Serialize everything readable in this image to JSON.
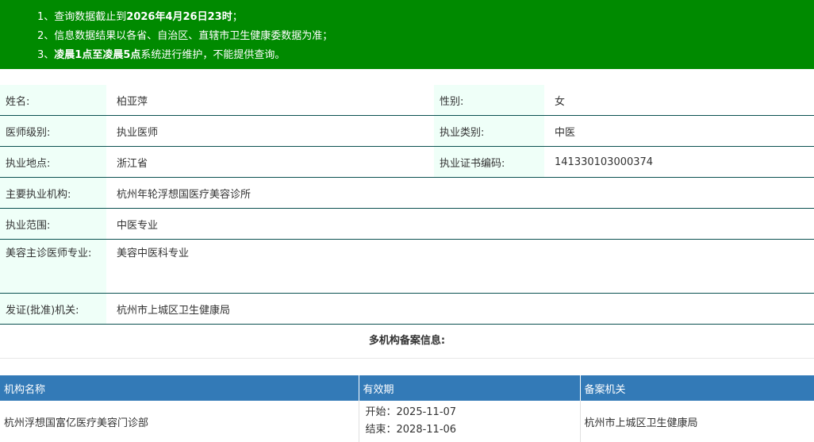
{
  "notice": {
    "line1_prefix": "1、查询数据截止到",
    "line1_bold": "2026年4月26日23时",
    "line1_suffix": "；",
    "line2": "2、信息数据结果以各省、自治区、直辖市卫生健康委数据为准；",
    "line3_prefix": "3、",
    "line3_bold": "凌晨1点至凌晨5点",
    "line3_suffix": "系统进行维护，不能提供查询。"
  },
  "info": {
    "name_label": "姓名:",
    "name_value": "柏亚萍",
    "gender_label": "性别:",
    "gender_value": "女",
    "level_label": "医师级别:",
    "level_value": "执业医师",
    "category_label": "执业类别:",
    "category_value": "中医",
    "location_label": "执业地点:",
    "location_value": "浙江省",
    "cert_label": "执业证书编码:",
    "cert_value": "141330103000374",
    "org_label": "主要执业机构:",
    "org_value": "杭州年轮浮想国医疗美容诊所",
    "scope_label": "执业范围:",
    "scope_value": "中医专业",
    "cosmetic_label": "美容主诊医师专业:",
    "cosmetic_value": "美容中医科专业",
    "issuer_label": "发证(批准)机关:",
    "issuer_value": "杭州市上城区卫生健康局"
  },
  "multi": {
    "title": "多机构备案信息:",
    "headers": [
      "机构名称",
      "有效期",
      "备案机关"
    ],
    "rows": [
      {
        "org": "杭州浮想国富亿医疗美容门诊部",
        "start": "开始：2025-11-07",
        "end": "结束：2028-11-06",
        "authority": "杭州市上城区卫生健康局"
      }
    ]
  }
}
